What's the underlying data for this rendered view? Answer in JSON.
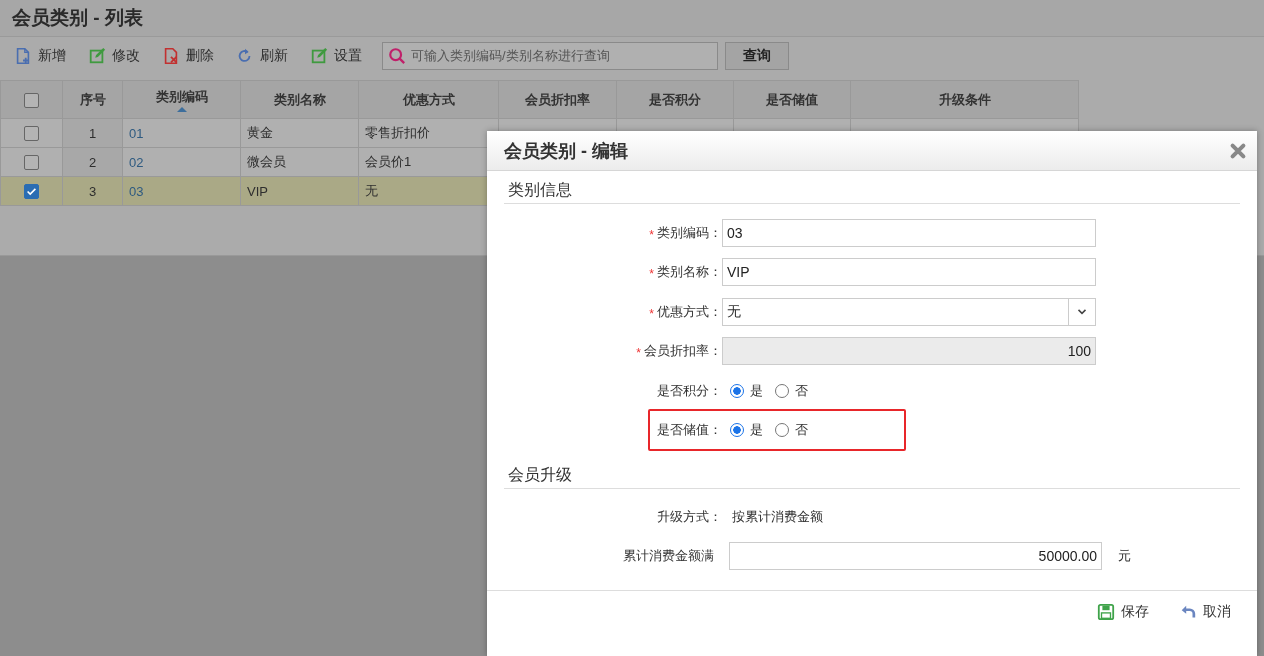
{
  "page": {
    "title": "会员类别 - 列表"
  },
  "toolbar": {
    "buttons": [
      {
        "label": "新增"
      },
      {
        "label": "修改"
      },
      {
        "label": "删除"
      },
      {
        "label": "刷新"
      },
      {
        "label": "设置"
      }
    ],
    "search": {
      "placeholder": "可输入类别编码/类别名称进行查询"
    },
    "search_button": "查询"
  },
  "table": {
    "all_checked": false,
    "columns": [
      {
        "label": "序号",
        "sorted": false
      },
      {
        "label": "类别编码",
        "sorted": true
      },
      {
        "label": "类别名称",
        "sorted": false
      },
      {
        "label": "优惠方式",
        "sorted": false
      },
      {
        "label": "会员折扣率",
        "sorted": false
      },
      {
        "label": "是否积分",
        "sorted": false
      },
      {
        "label": "是否储值",
        "sorted": false
      },
      {
        "label": "升级条件",
        "sorted": false
      }
    ],
    "rows": [
      {
        "selected": false,
        "cells": [
          "1",
          "01",
          "黄金",
          "零售折扣价"
        ]
      },
      {
        "selected": false,
        "cells": [
          "2",
          "02",
          "微会员",
          "会员价1"
        ]
      },
      {
        "selected": true,
        "cells": [
          "3",
          "03",
          "VIP",
          "无"
        ]
      }
    ]
  },
  "dialog": {
    "title": "会员类别 - 编辑",
    "sections": [
      {
        "title": "类别信息",
        "fields": [
          {
            "kind": "text",
            "label": "类别编码：",
            "required_mark": "*",
            "value": "03"
          },
          {
            "kind": "text",
            "label": "类别名称：",
            "required_mark": "*",
            "value": "VIP"
          },
          {
            "kind": "select",
            "label": "优惠方式：",
            "required_mark": "*",
            "value": "无"
          },
          {
            "kind": "readonly",
            "label": "会员折扣率：",
            "required_mark": "*",
            "value": "100"
          },
          {
            "kind": "radio",
            "label": "是否积分：",
            "options": [
              {
                "label": "是",
                "selected": true
              },
              {
                "label": "否",
                "selected": false
              }
            ]
          },
          {
            "kind": "radio",
            "label": "是否储值：",
            "highlighted": true,
            "options": [
              {
                "label": "是",
                "selected": true
              },
              {
                "label": "否",
                "selected": false
              }
            ]
          }
        ]
      },
      {
        "title": "会员升级",
        "fields": [
          {
            "kind": "static",
            "label": "升级方式：",
            "value": "按累计消费金额"
          },
          {
            "kind": "amount",
            "label": "累计消费金额满",
            "value": "50000.00",
            "unit": "元"
          }
        ]
      }
    ],
    "buttons": [
      {
        "label": "保存"
      },
      {
        "label": "取消"
      }
    ]
  }
}
